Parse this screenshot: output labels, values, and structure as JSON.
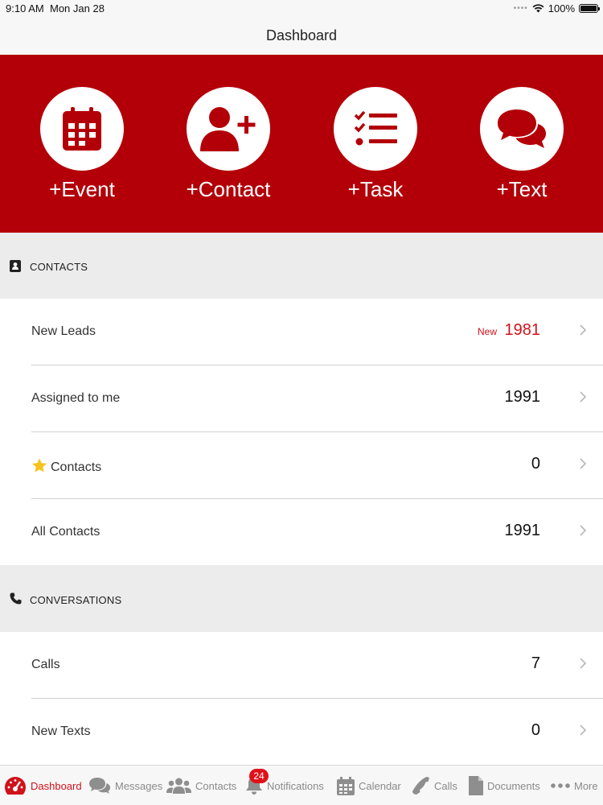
{
  "status_bar": {
    "time": "9:10 AM",
    "date": "Mon Jan 28",
    "battery": "100%"
  },
  "nav": {
    "title": "Dashboard"
  },
  "actions": [
    {
      "label": "+Event",
      "icon": "calendar-icon"
    },
    {
      "label": "+Contact",
      "icon": "add-contact-icon"
    },
    {
      "label": "+Task",
      "icon": "task-list-icon"
    },
    {
      "label": "+Text",
      "icon": "chat-bubbles-icon"
    }
  ],
  "contacts_section": {
    "header": "CONTACTS",
    "rows": [
      {
        "label": "New Leads",
        "badge": "New",
        "value": "1981"
      },
      {
        "label": "Assigned to me",
        "value": "1991"
      },
      {
        "label": "Contacts",
        "value": "0"
      },
      {
        "label": "All Contacts",
        "value": "1991"
      }
    ]
  },
  "conversations_section": {
    "header": "CONVERSATIONS",
    "rows": [
      {
        "label": "Calls",
        "value": "7"
      },
      {
        "label": "New Texts",
        "value": "0"
      }
    ]
  },
  "tab_bar": {
    "tabs": [
      {
        "label": "Dashboard",
        "icon": "speedometer-icon",
        "active": true
      },
      {
        "label": "Messages",
        "icon": "messages-icon"
      },
      {
        "label": "Contacts",
        "icon": "people-icon"
      },
      {
        "label": "Notifications",
        "icon": "bell-icon",
        "badge": "24"
      },
      {
        "label": "Calendar",
        "icon": "calendar-icon"
      },
      {
        "label": "Calls",
        "icon": "phone-icon"
      },
      {
        "label": "Documents",
        "icon": "document-icon"
      },
      {
        "label": "More",
        "icon": "more-dots-icon"
      }
    ]
  },
  "colors": {
    "brand_red": "#b30008",
    "accent_red": "#d0121b",
    "section_gray": "#ececec"
  }
}
